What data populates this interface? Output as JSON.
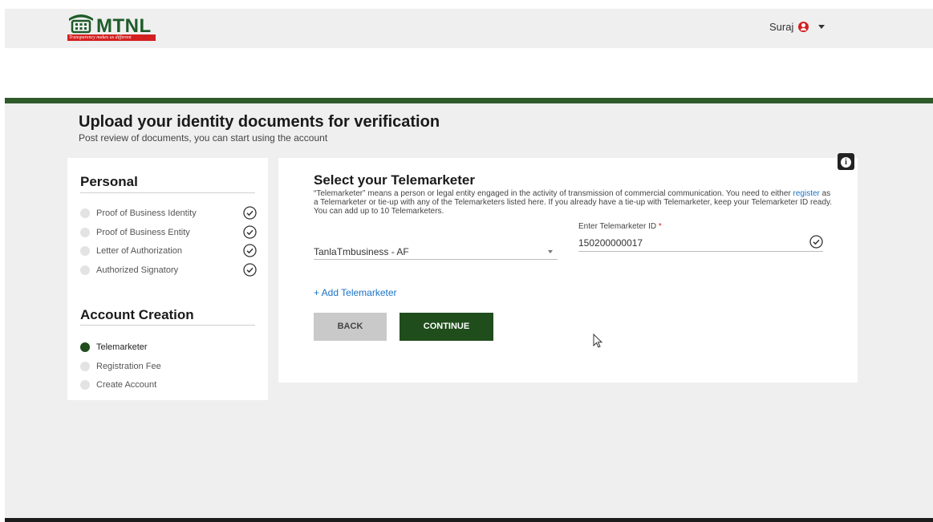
{
  "header": {
    "logo_text": "MTNL",
    "logo_tagline": "Transparency makes us different",
    "user_name": "Suraj"
  },
  "page": {
    "title": "Upload your identity documents for verification",
    "subtitle": "Post review of documents, you can start using the account"
  },
  "sidebar": {
    "personal_heading": "Personal",
    "personal_items": [
      {
        "label": "Proof of Business Identity",
        "completed": true
      },
      {
        "label": "Proof of Business Entity",
        "completed": true
      },
      {
        "label": "Letter of Authorization",
        "completed": true
      },
      {
        "label": "Authorized Signatory",
        "completed": true
      }
    ],
    "account_heading": "Account Creation",
    "account_items": [
      {
        "label": "Telemarketer",
        "active": true
      },
      {
        "label": "Registration Fee",
        "active": false
      },
      {
        "label": "Create Account",
        "active": false
      }
    ]
  },
  "main": {
    "title": "Select your Telemarketer",
    "desc_before": "“Telemarketer” means a person or legal entity engaged in the activity of transmission of commercial communication. You need to either ",
    "desc_link": "register",
    "desc_after": " as a Telemarketer or tie-up with any of the Telemarketers listed here. If you already have a tie-up with Telemarketer, keep your Telemarketer ID ready. You can add up to 10 Telemarketers.",
    "telemarketer_select_value": "TanlaTmbusiness - AF",
    "id_label": "Enter Telemarketer ID",
    "id_required_mark": "*",
    "id_value": "150200000017",
    "add_link": "+ Add Telemarketer",
    "back_label": "BACK",
    "continue_label": "CONTINUE"
  },
  "colors": {
    "brand_green": "#1f4d1c",
    "accent_red": "#d32020",
    "link_blue": "#1a73c4"
  }
}
